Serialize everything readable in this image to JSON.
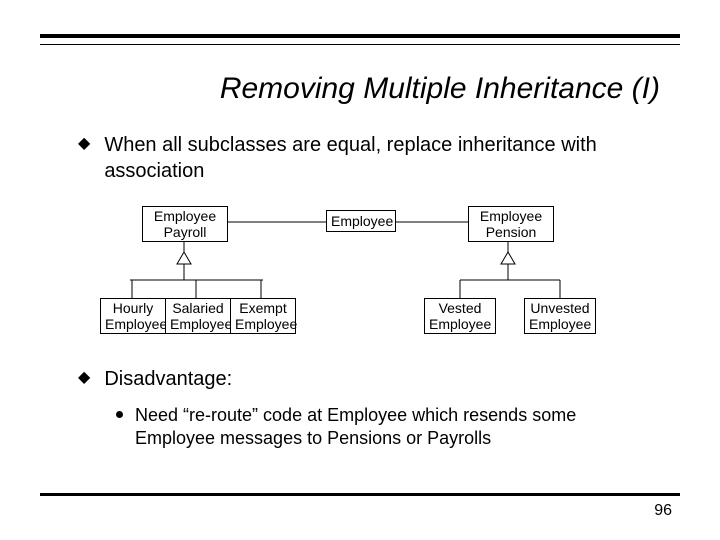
{
  "title": "Removing Multiple Inheritance (I)",
  "bullets": {
    "b1": "When all subclasses are equal, replace inheritance with association",
    "b2": "Disadvantage:",
    "sub1": "Need “re-route” code at Employee which resends some Employee messages to Pensions or Payrolls"
  },
  "diagram": {
    "payroll": "Employee\nPayroll",
    "employee": "Employee",
    "pension": "Employee\nPension",
    "hourly": "Hourly\nEmployee",
    "salaried": "Salaried\nEmployee",
    "exempt": "Exempt\nEmployee",
    "vested": "Vested\nEmployee",
    "unvested": "Unvested\nEmployee"
  },
  "pagenum": "96"
}
